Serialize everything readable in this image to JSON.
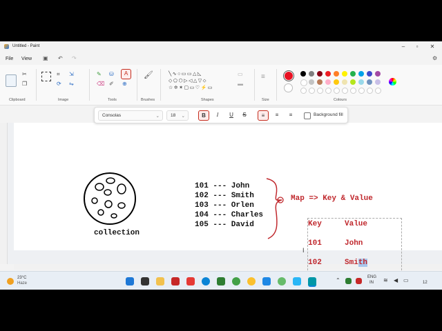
{
  "window": {
    "title": "Untitled - Paint"
  },
  "menu": {
    "file": "File",
    "view": "View"
  },
  "ribbon": {
    "groups": {
      "clipboard": "Clipboard",
      "image": "Image",
      "tools": "Tools",
      "brushes": "Brushes",
      "shapes": "Shapes",
      "size": "Size",
      "colours": "Colours"
    }
  },
  "text_toolbar": {
    "font": "Consolas",
    "size": "18",
    "bold": "B",
    "italic": "I",
    "underline": "U",
    "strike": "S",
    "background_fill": "Background fill"
  },
  "palette": {
    "current": "#e81123",
    "row1": [
      "#000000",
      "#7f7f7f",
      "#880015",
      "#ed1c24",
      "#ff7f27",
      "#fff200",
      "#22b14c",
      "#00a2e8",
      "#3f48cc",
      "#a349a4"
    ],
    "row2": [
      "#ffffff",
      "#c3c3c3",
      "#b97a57",
      "#ffaec9",
      "#ffc90e",
      "#efe4b0",
      "#b5e61d",
      "#99d9ea",
      "#7092be",
      "#c8bfe7"
    ]
  },
  "canvas": {
    "collection_label": "collection",
    "list": [
      "101 --- John",
      "102 --- Smith",
      "103 --- Orlen",
      "104 --- Charles",
      "105 --- David"
    ],
    "map_title": "Map => Key & Value",
    "table": {
      "headers": [
        "Key",
        "Value"
      ],
      "rows": [
        [
          "101",
          "John"
        ],
        [
          "102",
          "Smith"
        ]
      ]
    },
    "smith_prefix": "Smi",
    "smith_selected": "th"
  },
  "taskbar": {
    "temp": "23°C",
    "weather": "Haze",
    "lang1": "ENG",
    "lang2": "IN",
    "time_partial": "12"
  }
}
